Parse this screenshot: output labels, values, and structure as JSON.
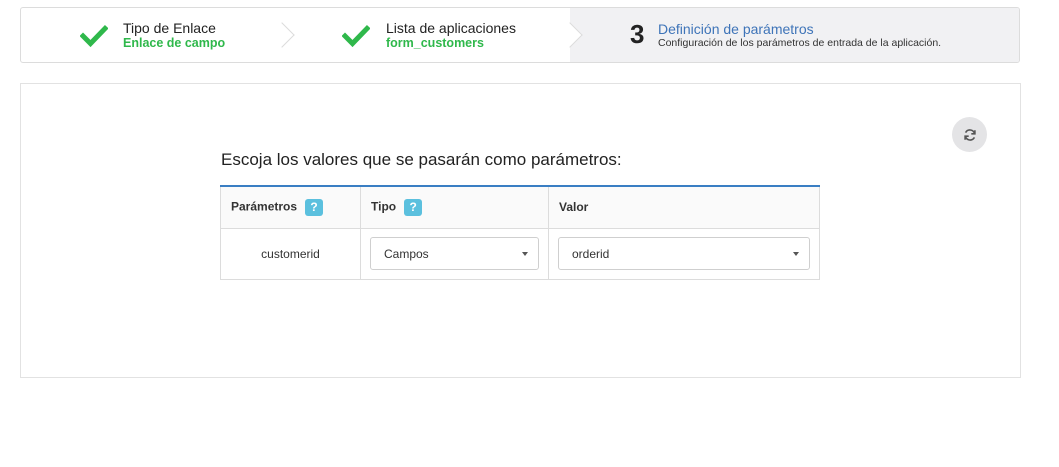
{
  "wizard": {
    "steps": [
      {
        "title": "Tipo de Enlace",
        "subtitle": "Enlace de campo",
        "status": "done",
        "icon": "check-icon"
      },
      {
        "title": "Lista de aplicaciones",
        "subtitle": "form_customers",
        "status": "done",
        "icon": "check-icon"
      },
      {
        "number": "3",
        "title": "Definición de parámetros",
        "subtitle": "Configuración de los parámetros de entrada de la aplicación.",
        "status": "active"
      }
    ],
    "colors": {
      "done": "#2fb84b",
      "active_title": "#3e74b8",
      "active_bg": "#f1f1f3"
    }
  },
  "panel": {
    "refresh_icon": "refresh-icon",
    "title": "Escoja los valores que se pasarán como parámetros:",
    "table": {
      "headers": [
        {
          "label": "Parámetros",
          "help": "?"
        },
        {
          "label": "Tipo",
          "help": "?"
        },
        {
          "label": "Valor"
        }
      ],
      "rows": [
        {
          "parameter": "customerid",
          "type": "Campos",
          "value": "orderid"
        }
      ]
    },
    "colors": {
      "table_accent": "#3a7ec3",
      "help_badge": "#5bc0de"
    }
  }
}
